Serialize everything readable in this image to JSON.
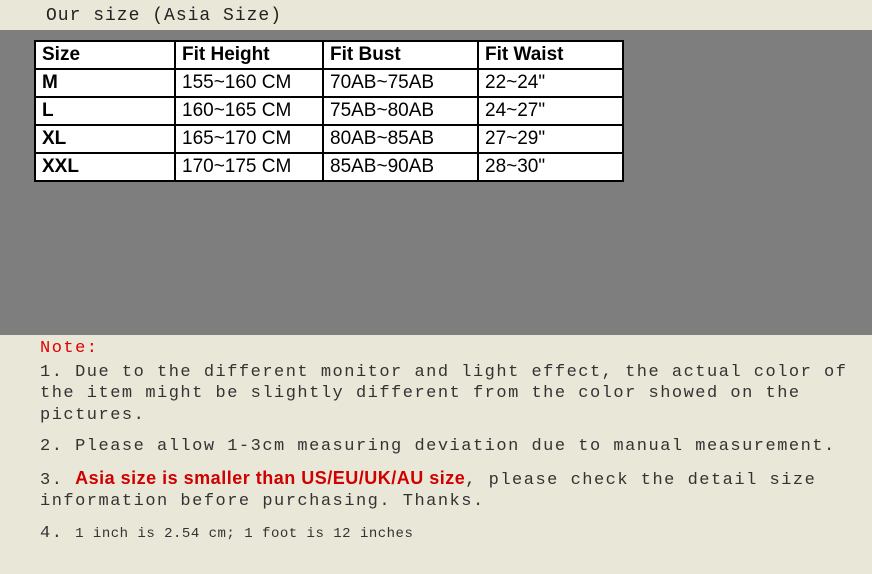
{
  "header": "Our size (Asia Size)",
  "table": {
    "headers": [
      "Size",
      "Fit Height",
      "Fit Bust",
      "Fit Waist"
    ],
    "rows": [
      [
        "M",
        "155~160 CM",
        "70AB~75AB",
        "22~24\""
      ],
      [
        "L",
        "160~165 CM",
        "75AB~80AB",
        "24~27\""
      ],
      [
        "XL",
        "165~170 CM",
        "80AB~85AB",
        "27~29\""
      ],
      [
        "XXL",
        "170~175 CM",
        "85AB~90AB",
        "28~30\""
      ]
    ]
  },
  "notes": {
    "label": "Note:",
    "line1": "1. Due to the different monitor and light effect, the actual color of the item might be slightly different from the color showed on the pictures.",
    "line2": "2. Please allow 1-3cm measuring deviation due to manual measurement.",
    "line3_prefix": "3. ",
    "line3_bold": "Asia size is smaller than US/EU/UK/AU size",
    "line3_suffix": ", please check the detail size information before purchasing. Thanks.",
    "line4_prefix": "4.  ",
    "line4_small": "1 inch is 2.54 cm; 1 foot  is 12 inches"
  }
}
